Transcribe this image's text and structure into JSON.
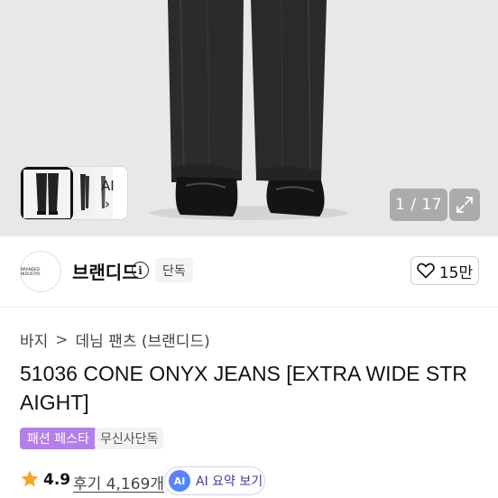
{
  "gallery": {
    "counter": "1 / 17",
    "thumb_ai_label": "AI",
    "thumb_ai_chevron": "›"
  },
  "brand": {
    "logo_text": "BRANDED INDUSTRY",
    "name": "브랜디드",
    "exclusive_badge": "단독",
    "like_count": "15만"
  },
  "breadcrumb": {
    "items": [
      "바지",
      "데님 팬츠 (브랜디드)"
    ],
    "separator": ">"
  },
  "product": {
    "title": "51036 CONE ONYX JEANS [EXTRA WIDE STRAIGHT]",
    "tags": [
      "패션 페스타",
      "무신사단독"
    ],
    "rating": "4.9",
    "reviews": "후기 4,169개",
    "ai_summary_icon": "AI",
    "ai_summary_label": "AI 요약 보기"
  },
  "icons": {
    "expand": "expand-icon",
    "info": "info-icon",
    "heart": "heart-icon",
    "star": "star-icon",
    "chevron": "chevron-right-icon"
  },
  "colors": {
    "star": "#f5a623",
    "fest_tag": "#b57ee9",
    "ai_text": "#3f3aa8"
  }
}
